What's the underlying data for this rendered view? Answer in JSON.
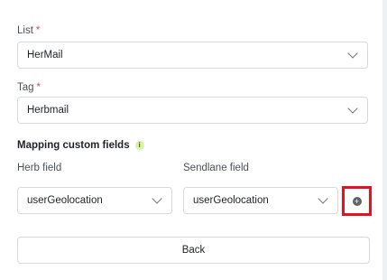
{
  "list": {
    "label": "List",
    "required": "*",
    "value": "HerMail"
  },
  "tag": {
    "label": "Tag",
    "required": "*",
    "value": "Herbmail"
  },
  "mapping": {
    "title": "Mapping custom fields",
    "info_icon": "info-icon",
    "info_glyph": "i",
    "herb_field_label": "Herb field",
    "sendlane_field_label": "Sendlane field",
    "herb_field_value": "userGeolocation",
    "sendlane_field_value": "userGeolocation",
    "add_icon": "plus-circle-icon",
    "add_glyph": "+"
  },
  "back_label": "Back",
  "colors": {
    "required": "#e5484d",
    "highlight": "#e0161c",
    "info_bg": "#d9f2a8"
  }
}
